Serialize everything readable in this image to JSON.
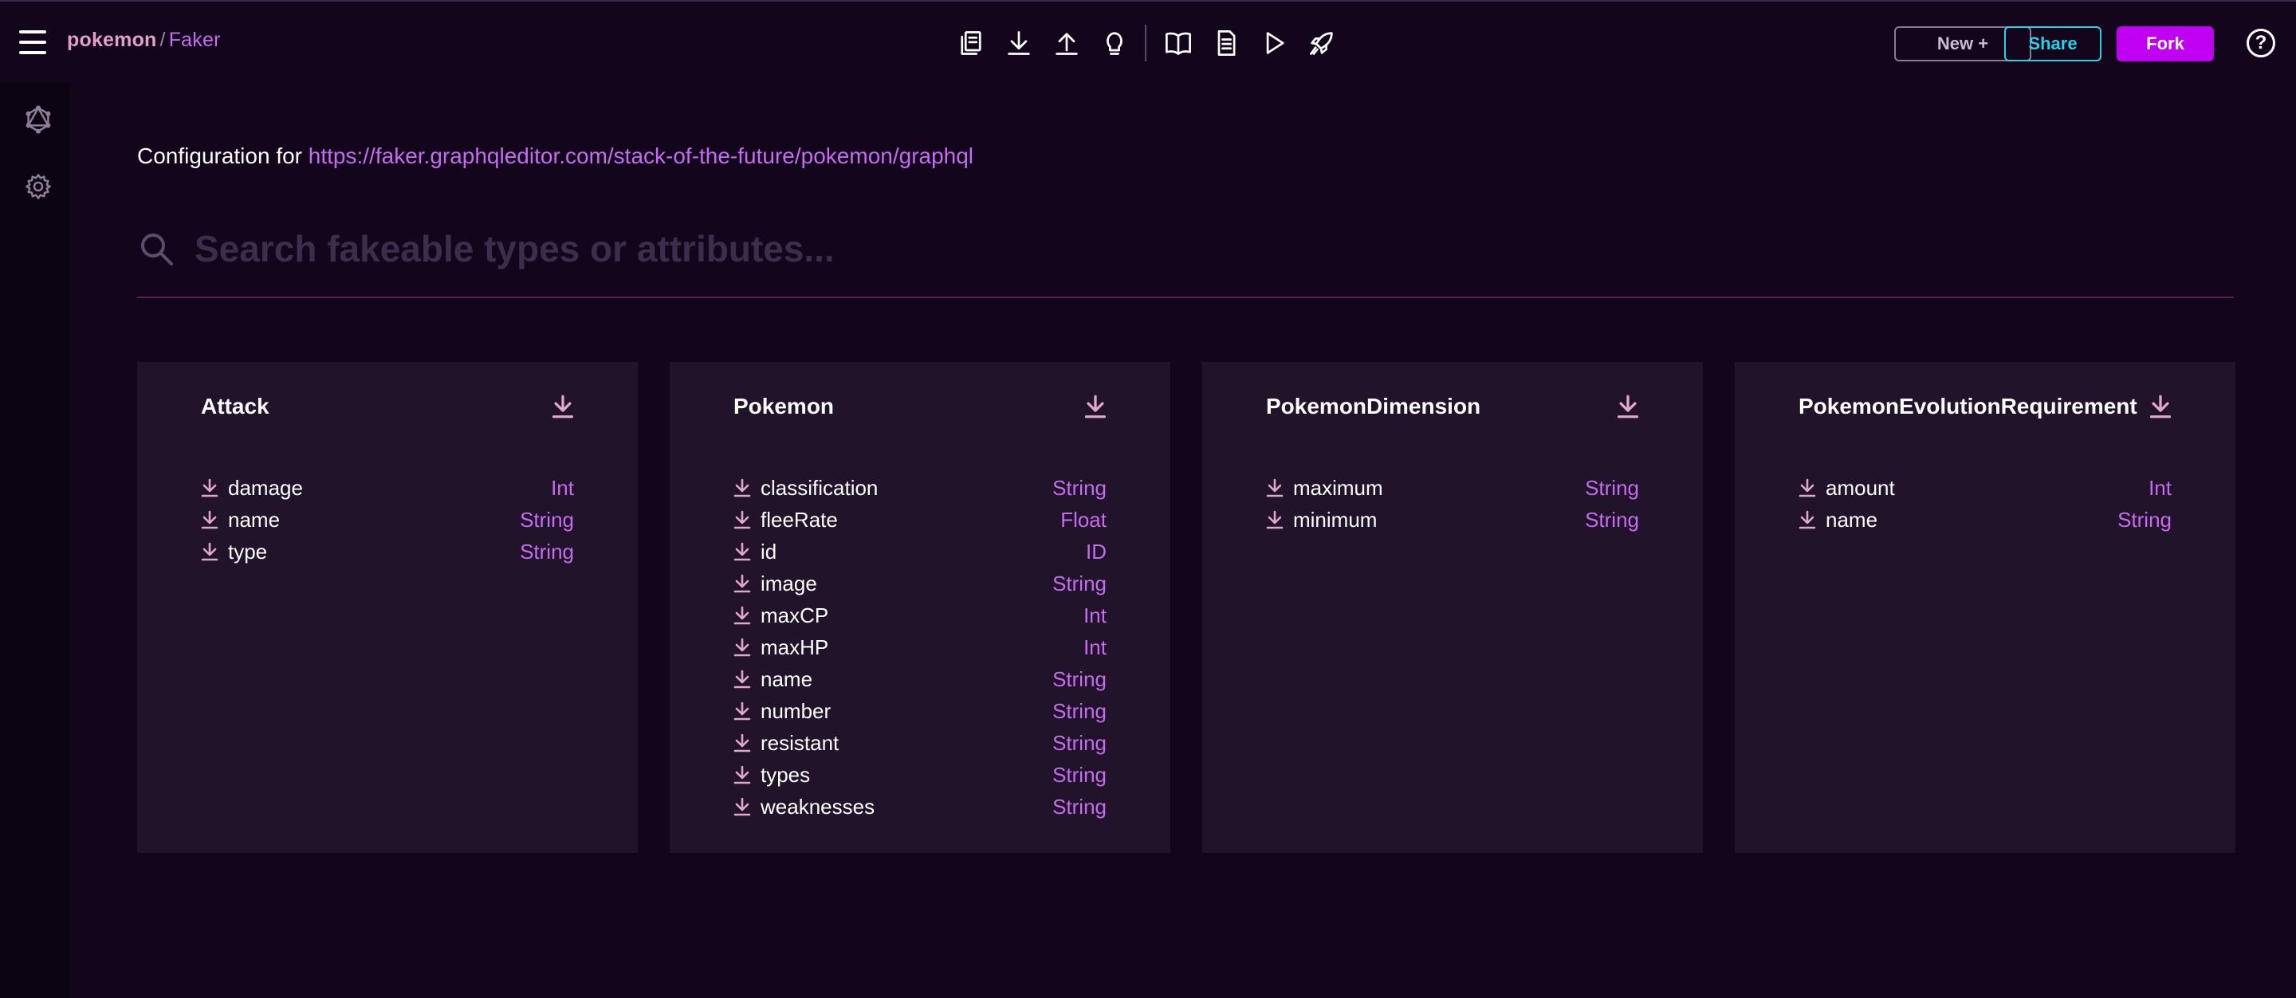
{
  "header": {
    "project": "pokemon",
    "separator": "/",
    "page": "Faker",
    "new_label": "New +",
    "share_label": "Share",
    "fork_label": "Fork",
    "help_label": "?"
  },
  "toolbar": {
    "icons": [
      "copy-icon",
      "download-icon",
      "upload-icon",
      "lightbulb-icon",
      "book-icon",
      "document-icon",
      "play-icon",
      "rocket-icon"
    ]
  },
  "sidebar": {
    "icons": [
      "graphql-icon",
      "settings-gear-icon"
    ]
  },
  "config": {
    "label": "Configuration for",
    "url": "https://faker.graphqleditor.com/stack-of-the-future/pokemon/graphql"
  },
  "search": {
    "placeholder": "Search fakeable types or attributes..."
  },
  "types": [
    {
      "name": "Attack",
      "fields": [
        {
          "name": "damage",
          "type": "Int"
        },
        {
          "name": "name",
          "type": "String"
        },
        {
          "name": "type",
          "type": "String"
        }
      ]
    },
    {
      "name": "Pokemon",
      "fields": [
        {
          "name": "classification",
          "type": "String"
        },
        {
          "name": "fleeRate",
          "type": "Float"
        },
        {
          "name": "id",
          "type": "ID"
        },
        {
          "name": "image",
          "type": "String"
        },
        {
          "name": "maxCP",
          "type": "Int"
        },
        {
          "name": "maxHP",
          "type": "Int"
        },
        {
          "name": "name",
          "type": "String"
        },
        {
          "name": "number",
          "type": "String"
        },
        {
          "name": "resistant",
          "type": "String"
        },
        {
          "name": "types",
          "type": "String"
        },
        {
          "name": "weaknesses",
          "type": "String"
        }
      ]
    },
    {
      "name": "PokemonDimension",
      "fields": [
        {
          "name": "maximum",
          "type": "String"
        },
        {
          "name": "minimum",
          "type": "String"
        }
      ]
    },
    {
      "name": "PokemonEvolutionRequirement",
      "fields": [
        {
          "name": "amount",
          "type": "Int"
        },
        {
          "name": "name",
          "type": "String"
        }
      ]
    }
  ],
  "colors": {
    "background": "#13051c",
    "card": "#211329",
    "accent": "#c56cf0",
    "fork": "#c000f0",
    "share": "#2ad0e4"
  }
}
